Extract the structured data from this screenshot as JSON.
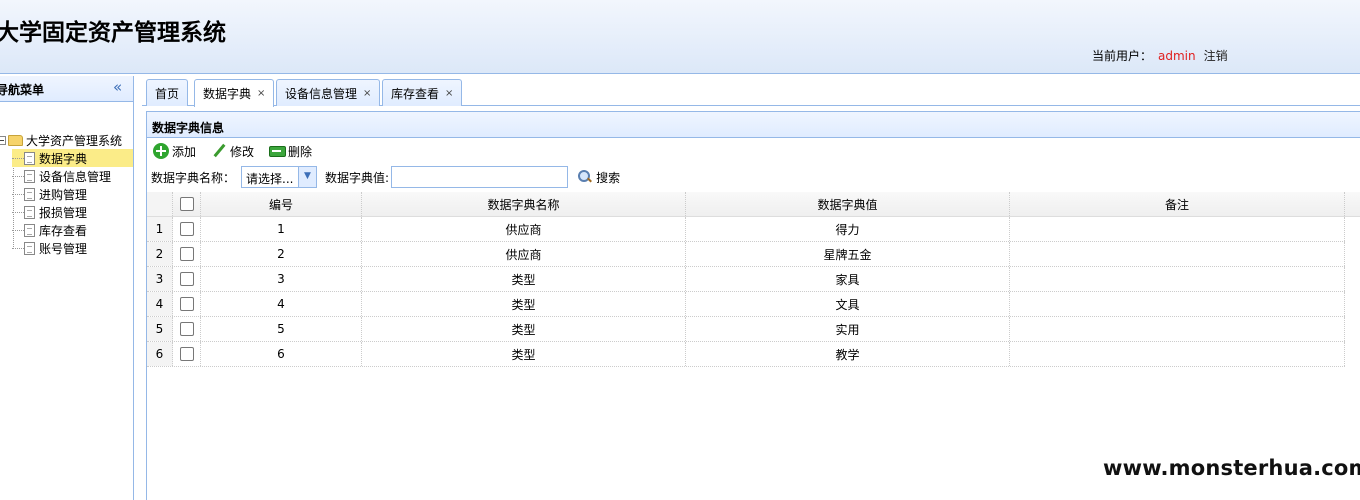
{
  "header": {
    "title": "大学固定资产管理系统",
    "current_user_label": "当前用户：",
    "username": "admin",
    "logout": "注销"
  },
  "nav": {
    "title": "导航菜单",
    "collapse_icon": "double-chevron-left-icon",
    "root": "大学资产管理系统",
    "items": [
      {
        "label": "数据字典",
        "selected": true
      },
      {
        "label": "设备信息管理"
      },
      {
        "label": "进购管理"
      },
      {
        "label": "报损管理"
      },
      {
        "label": "库存查看"
      },
      {
        "label": "账号管理"
      }
    ]
  },
  "tabs": [
    {
      "label": "首页",
      "closable": false
    },
    {
      "label": "数据字典",
      "closable": true,
      "active": true,
      "close": "×"
    },
    {
      "label": "设备信息管理",
      "closable": true,
      "close": "×"
    },
    {
      "label": "库存查看",
      "closable": true,
      "close": "×"
    }
  ],
  "panel": {
    "title": "数据字典信息",
    "toolbar": {
      "add": "添加",
      "edit": "修改",
      "delete": "删除"
    },
    "search": {
      "name_label": "数据字典名称：",
      "name_select": "请选择...",
      "value_label": "数据字典值:",
      "value_input": "",
      "search_button": "搜索"
    }
  },
  "table": {
    "columns": [
      "编号",
      "数据字典名称",
      "数据字典值",
      "备注"
    ],
    "rows": [
      {
        "rn": "1",
        "id": "1",
        "name": "供应商",
        "value": "得力",
        "note": ""
      },
      {
        "rn": "2",
        "id": "2",
        "name": "供应商",
        "value": "星牌五金",
        "note": ""
      },
      {
        "rn": "3",
        "id": "3",
        "name": "类型",
        "value": "家具",
        "note": ""
      },
      {
        "rn": "4",
        "id": "4",
        "name": "类型",
        "value": "文具",
        "note": ""
      },
      {
        "rn": "5",
        "id": "5",
        "name": "类型",
        "value": "实用",
        "note": ""
      },
      {
        "rn": "6",
        "id": "6",
        "name": "类型",
        "value": "教学",
        "note": ""
      }
    ]
  },
  "watermark": "www.monsterhua.com",
  "colors": {
    "border": "#95b8e7",
    "username": "#e02020",
    "selected": "#fbec88"
  }
}
